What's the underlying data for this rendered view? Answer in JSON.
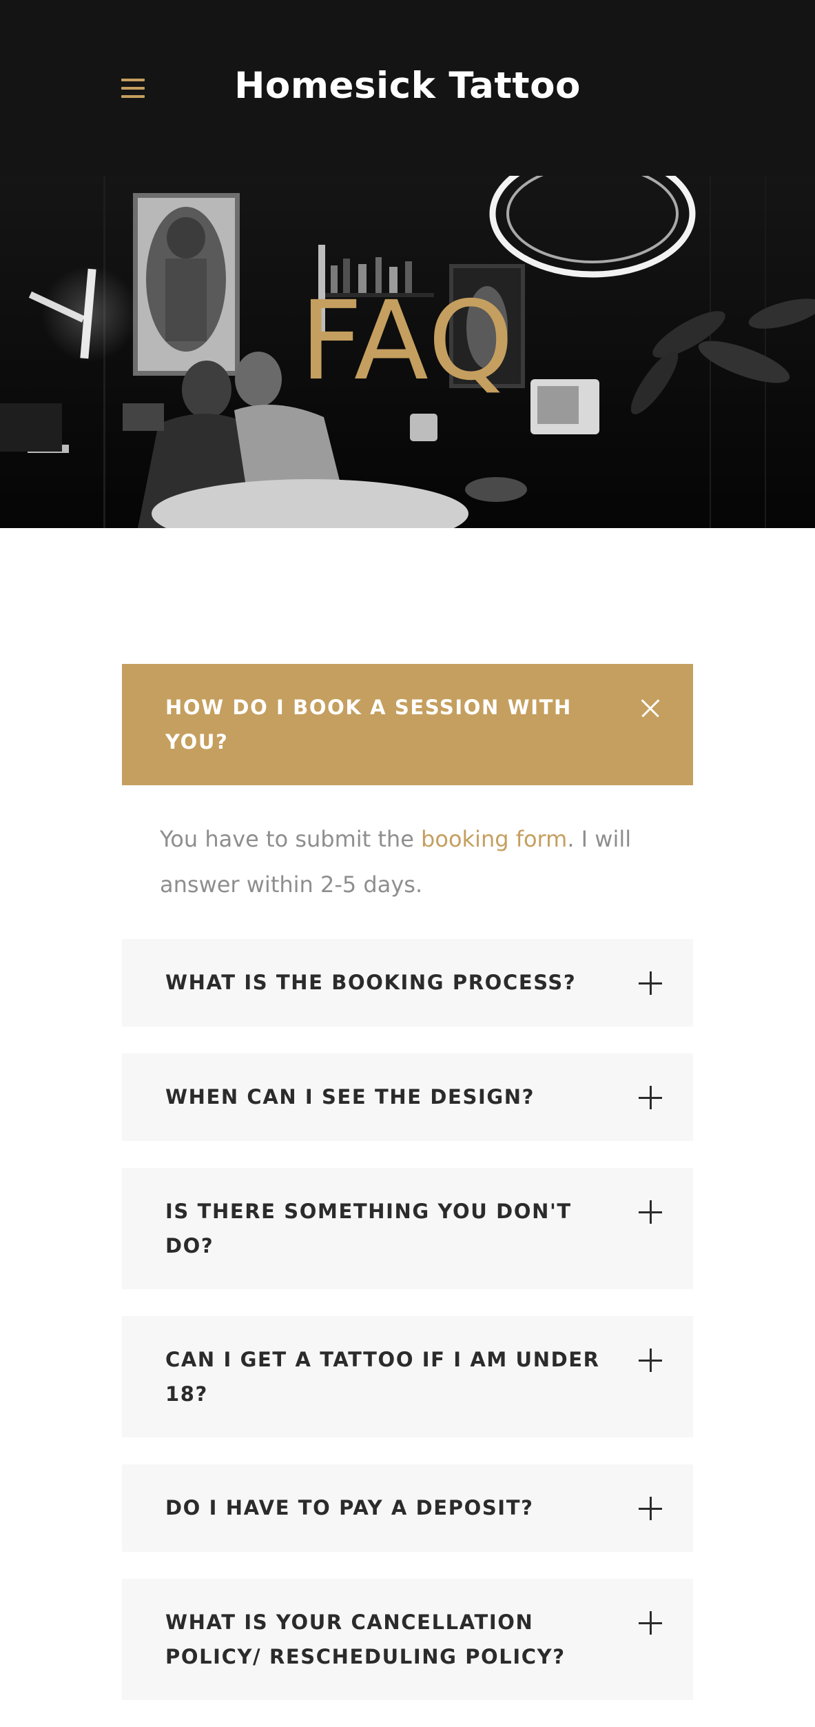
{
  "header": {
    "site_title": "Homesick Tattoo",
    "menu_icon": "hamburger-menu-icon"
  },
  "hero": {
    "title": "FAQ",
    "image": "tattoo-studio-photo"
  },
  "faq": {
    "items": [
      {
        "question": "HOW DO I BOOK A SESSION WITH YOU?",
        "open": true,
        "toggle_icon": "close-icon",
        "answer_before": "You have to submit the ",
        "answer_link": "booking form",
        "answer_after": ". I will answer within 2-5 days."
      },
      {
        "question": "WHAT IS THE BOOKING PROCESS?",
        "open": false,
        "toggle_icon": "plus-icon"
      },
      {
        "question": "WHEN CAN I SEE THE DESIGN?",
        "open": false,
        "toggle_icon": "plus-icon"
      },
      {
        "question": "IS THERE SOMETHING YOU DON'T DO?",
        "open": false,
        "toggle_icon": "plus-icon"
      },
      {
        "question": "CAN I GET A TATTOO IF I AM UNDER 18?",
        "open": false,
        "toggle_icon": "plus-icon"
      },
      {
        "question": "DO I HAVE TO PAY A DEPOSIT?",
        "open": false,
        "toggle_icon": "plus-icon"
      },
      {
        "question": "WHAT IS YOUR CANCELLATION POLICY/ RESCHEDULING POLICY?",
        "open": false,
        "toggle_icon": "plus-icon"
      }
    ]
  },
  "colors": {
    "accent": "#c59f5f",
    "header_bg": "#141414",
    "item_bg": "#f7f7f7",
    "question_text": "#2b2b2b",
    "answer_text": "#8e8e8e"
  }
}
